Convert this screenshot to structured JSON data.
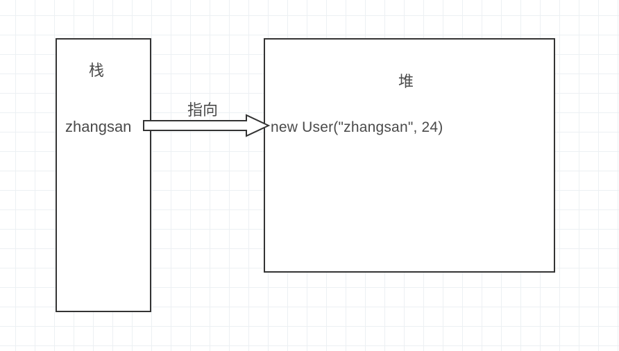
{
  "stack": {
    "title": "栈",
    "variable": "zhangsan"
  },
  "heap": {
    "title": "堆",
    "object_expr": "new User(\"zhangsan\", 24)"
  },
  "arrow": {
    "label": "指向"
  }
}
